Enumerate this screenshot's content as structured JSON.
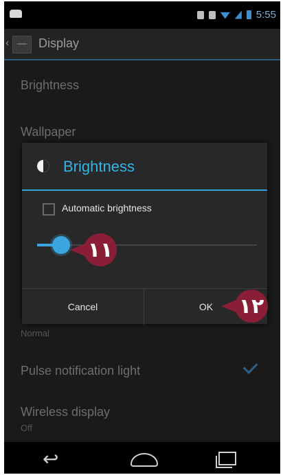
{
  "status_bar": {
    "time": "5:55"
  },
  "action_bar": {
    "title": "Display"
  },
  "settings": {
    "brightness": "Brightness",
    "wallpaper": "Wallpaper",
    "sleep_sub": "Normal",
    "pulse": "Pulse notification light",
    "wireless": "Wireless display",
    "wireless_sub": "Off"
  },
  "dialog": {
    "title": "Brightness",
    "auto_label": "Automatic brightness",
    "cancel": "Cancel",
    "ok": "OK"
  },
  "callouts": {
    "slider": "١١",
    "ok": "١٢"
  },
  "brightness_level": 0.11,
  "colors": {
    "accent": "#33b5e5",
    "callout": "#8a1e37"
  }
}
